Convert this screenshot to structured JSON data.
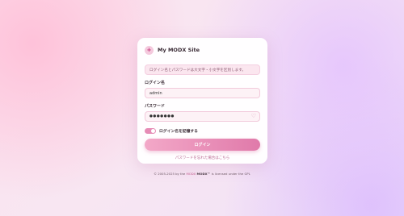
{
  "brand": {
    "logo_glyph": "+",
    "site_name": "My MODX Site"
  },
  "notice": {
    "text": "ログイン名とパスワードは大文字・小文字を区別します。"
  },
  "username": {
    "label": "ログイン名",
    "value": "admin"
  },
  "password": {
    "label": "パスワード",
    "value": "●●●●●●●",
    "icon": "heart-icon"
  },
  "remember": {
    "label": "ログイン名を記憶する",
    "checked": true
  },
  "login_button": {
    "label": "ログイン"
  },
  "forgot_link": {
    "label": "パスワードを忘れた場合はこちら"
  },
  "footer": {
    "prefix": "© 2005-2025 by the",
    "modx_link": "MODX",
    "modx_name": "MODX™",
    "suffix": "is licensed under the GPL"
  },
  "colors": {
    "accent": "#e07aaa",
    "accent_light": "#f3a8c8",
    "notice_bg": "#fbe6ef"
  }
}
